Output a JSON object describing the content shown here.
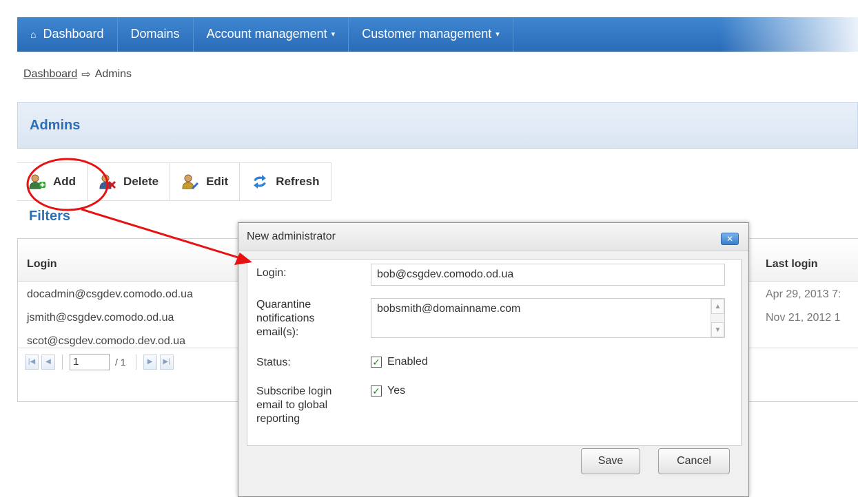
{
  "nav": {
    "items": [
      {
        "label": "Dashboard",
        "icon": "home-icon"
      },
      {
        "label": "Domains"
      },
      {
        "label": "Account management",
        "dropdown": true
      },
      {
        "label": "Customer management",
        "dropdown": true
      }
    ],
    "caret": "▾",
    "home_glyph": "⌂"
  },
  "breadcrumb": {
    "link": "Dashboard",
    "current": "Admins",
    "separator": "⇨"
  },
  "page_title": "Admins",
  "toolbar": {
    "add": "Add",
    "delete": "Delete",
    "edit": "Edit",
    "refresh": "Refresh"
  },
  "filters_label": "Filters",
  "table": {
    "columns": {
      "login": "Login",
      "last_login": "Last login"
    },
    "rows": [
      {
        "login": "docadmin@csgdev.comodo.od.ua",
        "last_login": "Apr 29, 2013 7:"
      },
      {
        "login": "jsmith@csgdev.comodo.od.ua",
        "last_login": "Nov 21, 2012 1"
      },
      {
        "login": "scot@csgdev.comodo.dev.od.ua",
        "last_login": ""
      }
    ],
    "pager": {
      "page": "1",
      "total": "/ 1"
    }
  },
  "dialog": {
    "title": "New administrator",
    "close_glyph": "✕",
    "login_label": "Login:",
    "login_value": "bob@csgdev.comodo.od.ua",
    "email_label": "Quarantine notifications email(s):",
    "email_value": "bobsmith@domainname.com",
    "status_label": "Status:",
    "status_value": "Enabled",
    "status_checked": true,
    "subscribe_label": "Subscribe login email to global reporting",
    "subscribe_value": "Yes",
    "subscribe_checked": true,
    "save": "Save",
    "cancel": "Cancel",
    "check_glyph": "✓"
  },
  "colors": {
    "nav_blue": "#2a6cb8",
    "title_blue": "#2a6fb8",
    "annotation_red": "#e81010"
  }
}
